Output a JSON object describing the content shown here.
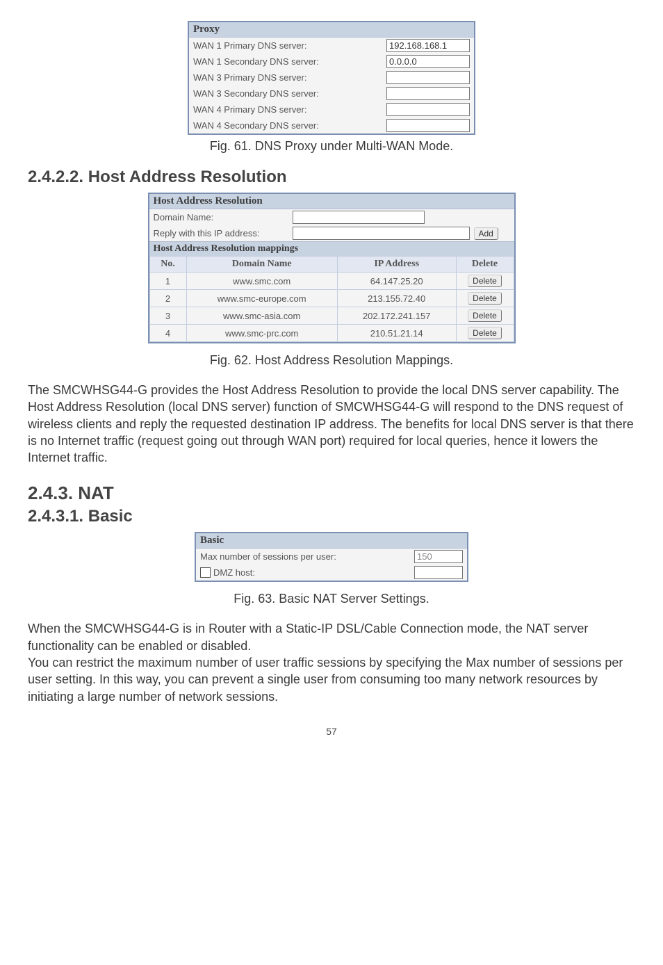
{
  "proxy": {
    "title": "Proxy",
    "rows": [
      {
        "label": "WAN 1 Primary DNS server:",
        "value": "192.168.168.1"
      },
      {
        "label": "WAN 1 Secondary DNS server:",
        "value": "0.0.0.0"
      },
      {
        "label": "WAN 3 Primary DNS server:",
        "value": ""
      },
      {
        "label": "WAN 3 Secondary DNS server:",
        "value": ""
      },
      {
        "label": "WAN 4 Primary DNS server:",
        "value": ""
      },
      {
        "label": "WAN 4 Secondary DNS server:",
        "value": ""
      }
    ],
    "caption": "Fig. 61. DNS Proxy under Multi-WAN Mode."
  },
  "section_2422": {
    "heading": "2.4.2.2. Host Address Resolution",
    "panel_title": "Host Address Resolution",
    "domain_label": "Domain Name:",
    "domain_value": "",
    "reply_label": "Reply with this IP address:",
    "reply_value": "",
    "add_button": "Add",
    "mappings_title": "Host Address Resolution mappings",
    "headers": {
      "no": "No.",
      "domain": "Domain Name",
      "ip": "IP Address",
      "delete": "Delete"
    },
    "rows": [
      {
        "no": "1",
        "domain": "www.smc.com",
        "ip": "64.147.25.20",
        "delete": "Delete"
      },
      {
        "no": "2",
        "domain": "www.smc-europe.com",
        "ip": "213.155.72.40",
        "delete": "Delete"
      },
      {
        "no": "3",
        "domain": "www.smc-asia.com",
        "ip": "202.172.241.157",
        "delete": "Delete"
      },
      {
        "no": "4",
        "domain": "www.smc-prc.com",
        "ip": "210.51.21.14",
        "delete": "Delete"
      }
    ],
    "caption": "Fig. 62. Host Address Resolution Mappings.",
    "paragraph": "The SMCWHSG44-G provides the Host Address Resolution to provide the local DNS server capability. The Host Address Resolution (local DNS server) function of SMCWHSG44-G will respond to the DNS request of wireless clients and reply the requested destination IP address. The benefits for local DNS server is that there is no Internet traffic (request going out through WAN port) required for local queries, hence it lowers the Internet traffic."
  },
  "section_243": {
    "heading": "2.4.3. NAT"
  },
  "section_2431": {
    "heading": "2.4.3.1. Basic",
    "panel_title": "Basic",
    "max_label": "Max number of sessions per user:",
    "max_value": "150",
    "dmz_label": "DMZ host:",
    "dmz_value": "",
    "caption": "Fig. 63. Basic NAT Server Settings.",
    "paragraph1": "When the SMCWHSG44-G is in Router with a Static-IP DSL/Cable Connection mode, the NAT server functionality can be enabled or disabled.",
    "paragraph2": "You can restrict the maximum number of user traffic sessions by specifying the Max number of sessions per user setting. In this way, you can prevent a single user from consuming too many network resources by initiating a large number of network sessions."
  },
  "page_number": "57"
}
